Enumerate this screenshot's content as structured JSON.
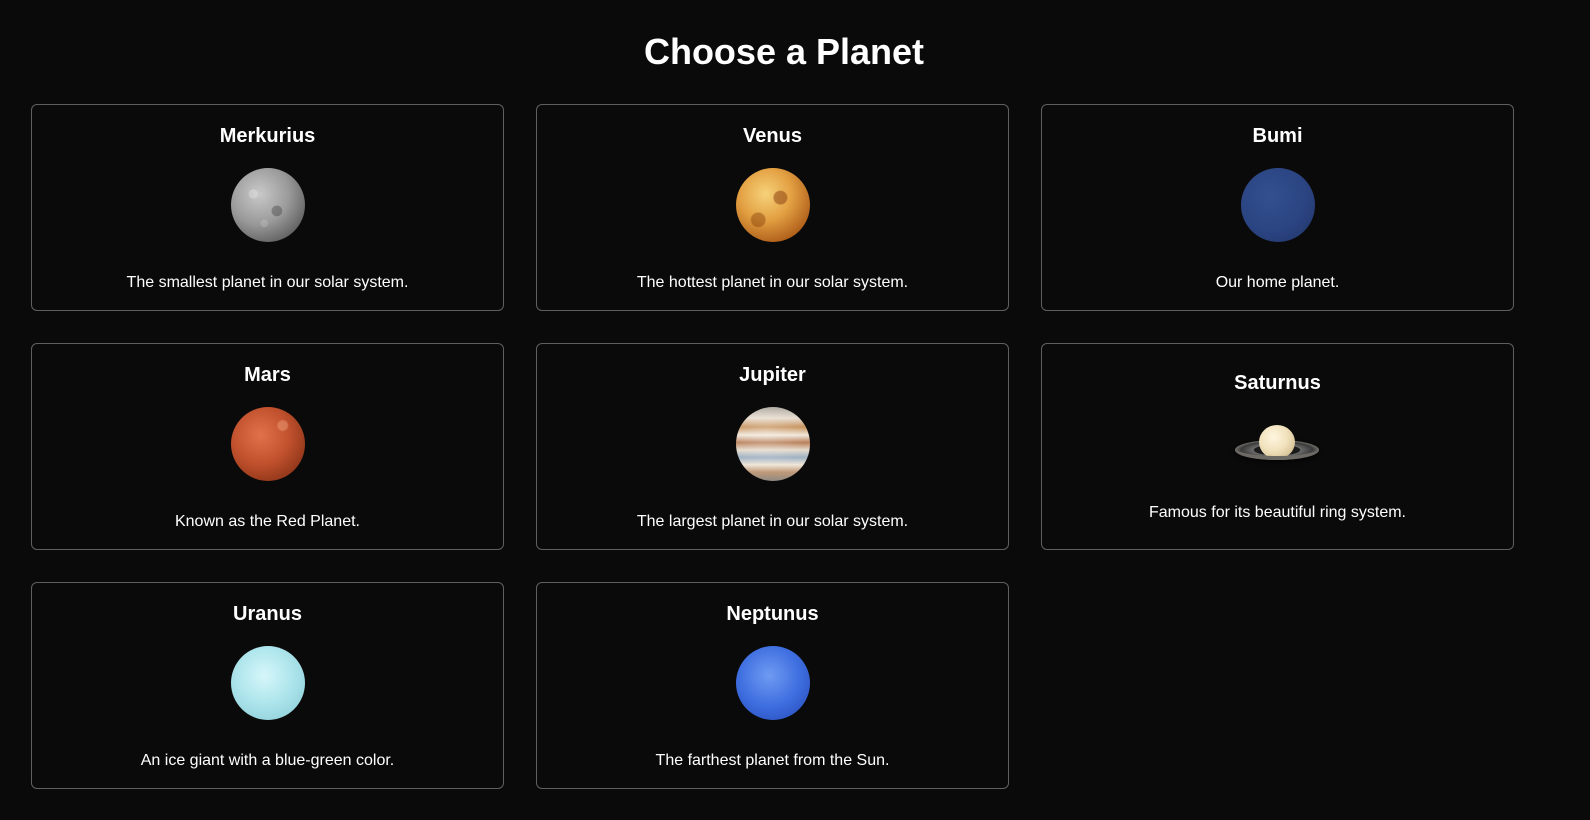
{
  "page": {
    "title": "Choose a Planet"
  },
  "planets": [
    {
      "name": "Merkurius",
      "description": "The smallest planet in our solar system.",
      "image": "mercury-image",
      "color": "#9a9a9a"
    },
    {
      "name": "Venus",
      "description": "The hottest planet in our solar system.",
      "image": "venus-image",
      "color": "#e3a042"
    },
    {
      "name": "Bumi",
      "description": "Our home planet.",
      "image": "earth-image",
      "color": "#2b4482"
    },
    {
      "name": "Mars",
      "description": "Known as the Red Planet.",
      "image": "mars-image",
      "color": "#c1512e"
    },
    {
      "name": "Jupiter",
      "description": "The largest planet in our solar system.",
      "image": "jupiter-image",
      "color": "#e8ddd0"
    },
    {
      "name": "Saturnus",
      "description": "Famous for its beautiful ring system.",
      "image": "saturn-image",
      "color": "#f1e2bd"
    },
    {
      "name": "Uranus",
      "description": "An ice giant with a blue-green color.",
      "image": "uranus-image",
      "color": "#b3e8ee"
    },
    {
      "name": "Neptunus",
      "description": "The farthest planet from the Sun.",
      "image": "neptune-image",
      "color": "#3f6fe0"
    }
  ],
  "theme": {
    "background": "#0a0a0a",
    "card_border": "#5f5f5f",
    "text": "#ffffff"
  }
}
